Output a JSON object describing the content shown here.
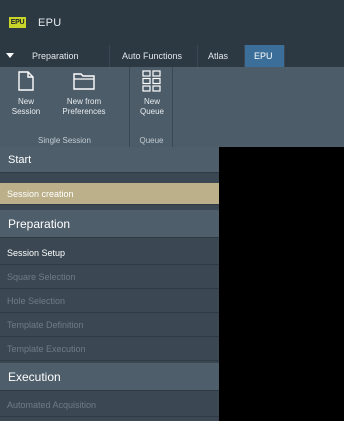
{
  "window": {
    "app_logo_text": "EPU",
    "title": "EPU"
  },
  "tabs": [
    {
      "label": "Preparation"
    },
    {
      "label": "Auto Functions"
    },
    {
      "label": "Atlas"
    },
    {
      "label": "EPU",
      "active": true
    }
  ],
  "ribbon": {
    "groups": [
      {
        "label": "Single Session",
        "buttons": [
          {
            "label": "New\nSession",
            "icon": "new-document-icon"
          },
          {
            "label": "New from\nPreferences",
            "icon": "folder-icon"
          }
        ]
      },
      {
        "label": "Queue",
        "buttons": [
          {
            "label": "New\nQueue",
            "icon": "queue-grid-icon"
          }
        ]
      }
    ]
  },
  "sidebar": {
    "sections": [
      {
        "title": "Start",
        "items": [
          {
            "label": "Session creation",
            "state": "selected"
          }
        ]
      },
      {
        "title": "Preparation",
        "items": [
          {
            "label": "Session Setup",
            "state": "enabled"
          },
          {
            "label": "Square Selection",
            "state": "disabled"
          },
          {
            "label": "Hole Selection",
            "state": "disabled"
          },
          {
            "label": "Template Definition",
            "state": "disabled"
          },
          {
            "label": "Template Execution",
            "state": "disabled"
          }
        ]
      },
      {
        "title": "Execution",
        "items": [
          {
            "label": "Automated Acquisition",
            "state": "disabled"
          }
        ]
      }
    ]
  },
  "colors": {
    "titlebar": "#2c3842",
    "active_tab": "#3b6f9a",
    "ribbon": "#4c5c69",
    "sidebar": "#3b4853",
    "section_header": "#4e5e6b",
    "selected_item": "#bcb08a",
    "logo_accent": "#c8d42a"
  }
}
